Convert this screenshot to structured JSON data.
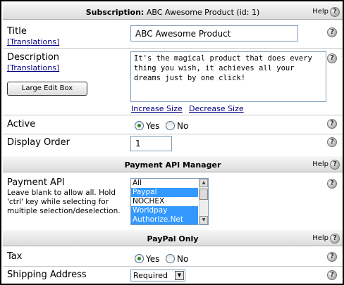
{
  "subscription_header": {
    "prefix": "Subscription:",
    "title": "ABC Awesome Product (id: 1)",
    "help": "Help"
  },
  "title_field": {
    "label": "Title",
    "translations": "[Translations]",
    "value": "ABC Awesome Product"
  },
  "description_field": {
    "label": "Description",
    "translations": "[Translations]",
    "large_edit_box": "Large Edit Box",
    "value": "It's the magical product that does every thing you wish, it achieves all your dreams just by one click!",
    "increase_size": "Increase Size",
    "decrease_size": "Decrease Size"
  },
  "active_field": {
    "label": "Active",
    "yes": "Yes",
    "no": "No",
    "selected": "Yes"
  },
  "display_order_field": {
    "label": "Display Order",
    "value": "1"
  },
  "payment_header": {
    "title": "Payment API Manager",
    "help": "Help"
  },
  "payment_api_field": {
    "label": "Payment API",
    "note": "Leave blank to allow all. Hold 'ctrl' key while selecting for multiple selection/deselection.",
    "options": [
      {
        "label": "All",
        "selected": false
      },
      {
        "label": "Paypal",
        "selected": true
      },
      {
        "label": "NOCHEX",
        "selected": false
      },
      {
        "label": "Worldpay",
        "selected": true
      },
      {
        "label": "Authorize.Net",
        "selected": true
      }
    ]
  },
  "paypal_header": {
    "title": "PayPal Only",
    "help": "Help"
  },
  "tax_field": {
    "label": "Tax",
    "yes": "Yes",
    "no": "No",
    "selected": "Yes"
  },
  "shipping_field": {
    "label": "Shipping Address",
    "value": "Required"
  },
  "help_icon_glyph": "?",
  "colors": {
    "selection": "#3399ff",
    "link": "#000080",
    "radio_on": "#2d8a23"
  }
}
